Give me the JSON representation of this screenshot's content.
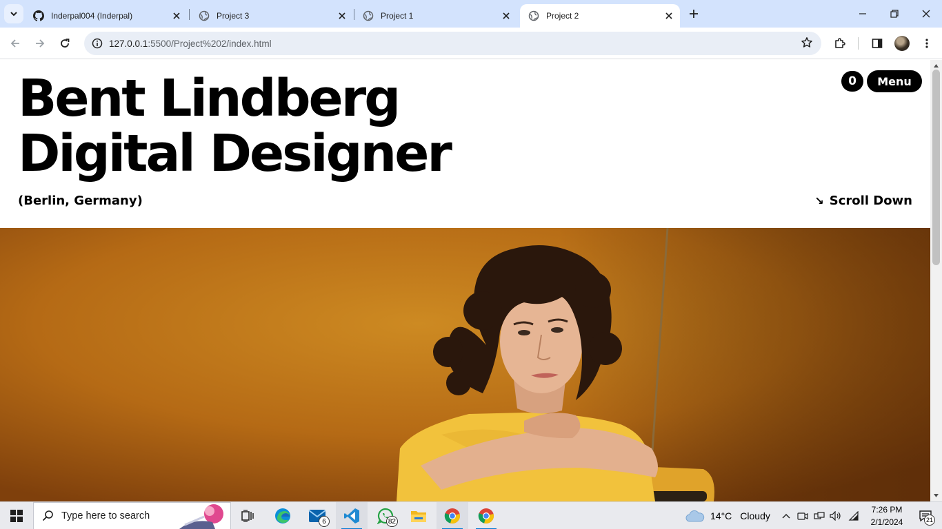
{
  "browser": {
    "tabs": [
      {
        "label": "Inderpal004 (Inderpal)",
        "icon": "github-icon",
        "active": false
      },
      {
        "label": "Project 3",
        "icon": "globe-icon",
        "active": false
      },
      {
        "label": "Project 1",
        "icon": "globe-icon",
        "active": false
      },
      {
        "label": "Project 2",
        "icon": "globe-icon",
        "active": true
      }
    ],
    "url_host": "127.0.0.1",
    "url_rest": ":5500/Project%202/index.html"
  },
  "page": {
    "title_line1": "Bent Lindberg",
    "title_line2": "Digital Designer",
    "location": "(Berlin, Germany)",
    "scroll_down": "Scroll Down",
    "scroll_arrow": "↘",
    "cart_count": "0",
    "menu_label": "Menu",
    "hero_bg_color": "#b86d17",
    "shirt_color": "#f2c23c"
  },
  "taskbar": {
    "search_placeholder": "Type here to search",
    "mail_badge": "6",
    "whatsapp_badge": "82",
    "weather_temp": "14°C",
    "weather_cond": "Cloudy",
    "time": "7:26 PM",
    "date": "2/1/2024",
    "notification_count": "21"
  }
}
